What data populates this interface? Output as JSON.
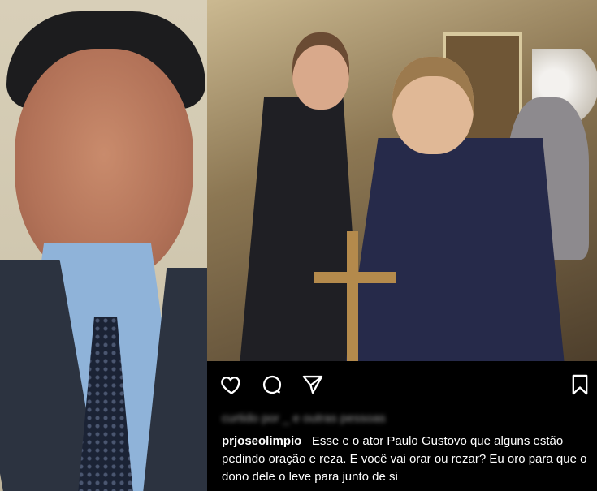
{
  "post": {
    "username": "prjoseolimpio_",
    "caption": "Esse e o ator Paulo Gustovo que alguns estão pedindo oração e reza. E você vai orar ou rezar? Eu oro para que o dono dele o leve para junto de si",
    "liked_by_blurred": "curtido por _ e outras pessoas",
    "icons": {
      "like": "heart-outline-icon",
      "comment": "comment-bubble-icon",
      "share": "paper-plane-icon",
      "save": "bookmark-icon"
    }
  }
}
